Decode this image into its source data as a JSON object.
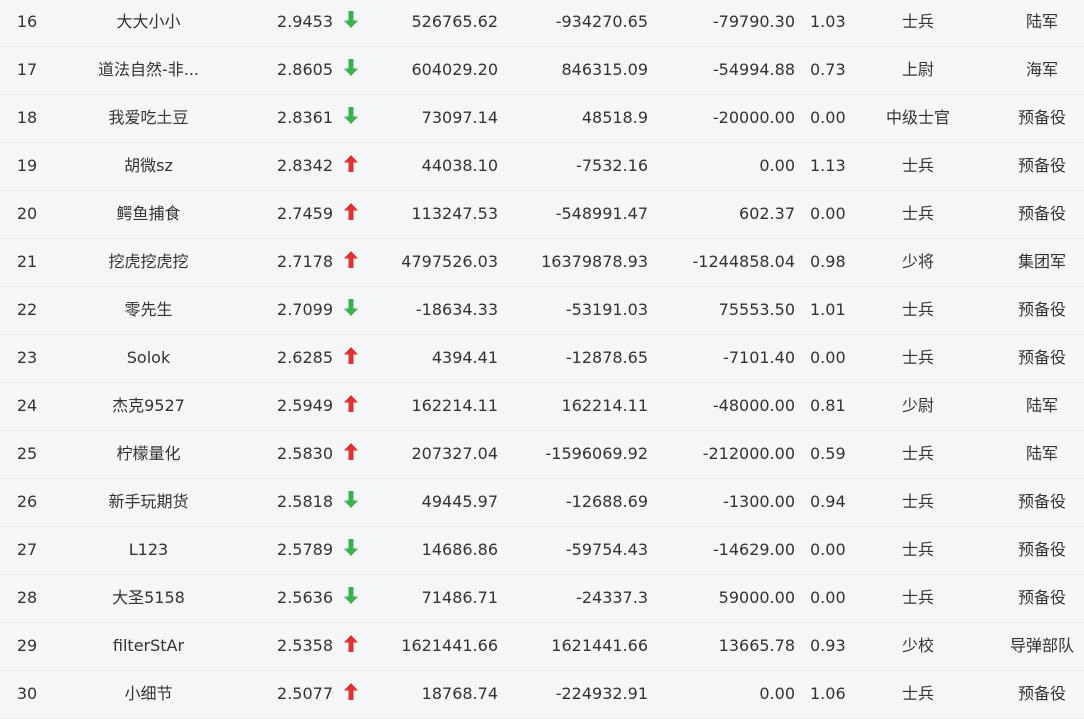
{
  "colors": {
    "background": "#f5f6f8",
    "text": "#333333",
    "down_arrow": "#37b24d",
    "up_arrow": "#e03131",
    "row_divider": "#e8e9ec"
  },
  "rows": [
    {
      "rank": "16",
      "name": "大大小小",
      "score": "2.9453",
      "trend": "down",
      "v1": "526765.62",
      "v2": "-934270.65",
      "v3": "-79790.30",
      "ratio": "1.03",
      "rank_title": "士兵",
      "unit": "陆军"
    },
    {
      "rank": "17",
      "name": "道法自然-非...",
      "score": "2.8605",
      "trend": "down",
      "v1": "604029.20",
      "v2": "846315.09",
      "v3": "-54994.88",
      "ratio": "0.73",
      "rank_title": "上尉",
      "unit": "海军"
    },
    {
      "rank": "18",
      "name": "我爱吃土豆",
      "score": "2.8361",
      "trend": "down",
      "v1": "73097.14",
      "v2": "48518.9",
      "v3": "-20000.00",
      "ratio": "0.00",
      "rank_title": "中级士官",
      "unit": "预备役"
    },
    {
      "rank": "19",
      "name": "胡微sz",
      "score": "2.8342",
      "trend": "up",
      "v1": "44038.10",
      "v2": "-7532.16",
      "v3": "0.00",
      "ratio": "1.13",
      "rank_title": "士兵",
      "unit": "预备役"
    },
    {
      "rank": "20",
      "name": "鳄鱼捕食",
      "score": "2.7459",
      "trend": "up",
      "v1": "113247.53",
      "v2": "-548991.47",
      "v3": "602.37",
      "ratio": "0.00",
      "rank_title": "士兵",
      "unit": "预备役"
    },
    {
      "rank": "21",
      "name": "挖虎挖虎挖",
      "score": "2.7178",
      "trend": "up",
      "v1": "4797526.03",
      "v2": "16379878.93",
      "v3": "-1244858.04",
      "ratio": "0.98",
      "rank_title": "少将",
      "unit": "集团军"
    },
    {
      "rank": "22",
      "name": "零先生",
      "score": "2.7099",
      "trend": "down",
      "v1": "-18634.33",
      "v2": "-53191.03",
      "v3": "75553.50",
      "ratio": "1.01",
      "rank_title": "士兵",
      "unit": "预备役"
    },
    {
      "rank": "23",
      "name": "Solok",
      "score": "2.6285",
      "trend": "up",
      "v1": "4394.41",
      "v2": "-12878.65",
      "v3": "-7101.40",
      "ratio": "0.00",
      "rank_title": "士兵",
      "unit": "预备役"
    },
    {
      "rank": "24",
      "name": "杰克9527",
      "score": "2.5949",
      "trend": "up",
      "v1": "162214.11",
      "v2": "162214.11",
      "v3": "-48000.00",
      "ratio": "0.81",
      "rank_title": "少尉",
      "unit": "陆军"
    },
    {
      "rank": "25",
      "name": "柠檬量化",
      "score": "2.5830",
      "trend": "up",
      "v1": "207327.04",
      "v2": "-1596069.92",
      "v3": "-212000.00",
      "ratio": "0.59",
      "rank_title": "士兵",
      "unit": "陆军"
    },
    {
      "rank": "26",
      "name": "新手玩期货",
      "score": "2.5818",
      "trend": "down",
      "v1": "49445.97",
      "v2": "-12688.69",
      "v3": "-1300.00",
      "ratio": "0.94",
      "rank_title": "士兵",
      "unit": "预备役"
    },
    {
      "rank": "27",
      "name": "L123",
      "score": "2.5789",
      "trend": "down",
      "v1": "14686.86",
      "v2": "-59754.43",
      "v3": "-14629.00",
      "ratio": "0.00",
      "rank_title": "士兵",
      "unit": "预备役"
    },
    {
      "rank": "28",
      "name": "大圣5158",
      "score": "2.5636",
      "trend": "down",
      "v1": "71486.71",
      "v2": "-24337.3",
      "v3": "59000.00",
      "ratio": "0.00",
      "rank_title": "士兵",
      "unit": "预备役"
    },
    {
      "rank": "29",
      "name": "filterStAr",
      "score": "2.5358",
      "trend": "up",
      "v1": "1621441.66",
      "v2": "1621441.66",
      "v3": "13665.78",
      "ratio": "0.93",
      "rank_title": "少校",
      "unit": "导弹部队"
    },
    {
      "rank": "30",
      "name": "小细节",
      "score": "2.5077",
      "trend": "up",
      "v1": "18768.74",
      "v2": "-224932.91",
      "v3": "0.00",
      "ratio": "1.06",
      "rank_title": "士兵",
      "unit": "预备役"
    }
  ]
}
